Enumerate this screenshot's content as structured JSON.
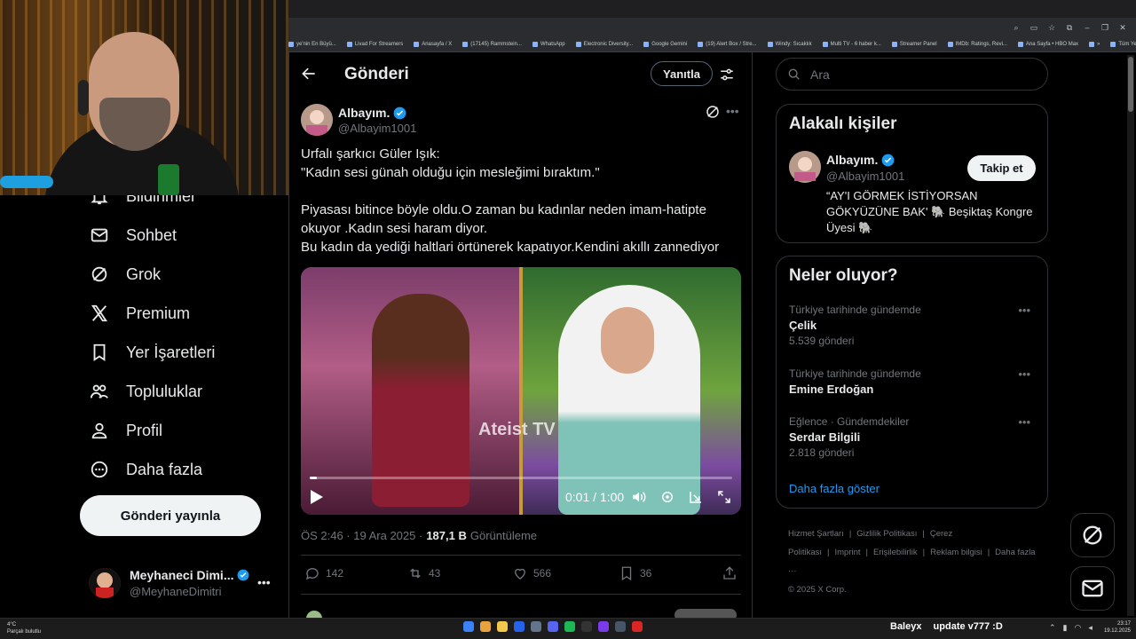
{
  "bookmarks": [
    "ye'nin En Büyü...",
    "Livad For Streamers",
    "Anasayfa / X",
    "(17145) Rammstein...",
    "WhatsApp",
    "Electronic Diversity...",
    "Google Gemini",
    "(19) Alert Box / Stre...",
    "Windy: Sıcaklık",
    "Multi TV - 6 haber k...",
    "Streamer Panel",
    "IMDb: Ratings, Revi...",
    "Ana Sayfa • HBO Max",
    "»",
    "Tüm Yer İşaretleri"
  ],
  "nav": {
    "items": [
      {
        "label": "Bildirimler",
        "icon": "bell-icon"
      },
      {
        "label": "Sohbet",
        "icon": "mail-icon"
      },
      {
        "label": "Grok",
        "icon": "grok-icon"
      },
      {
        "label": "Premium",
        "icon": "x-logo-icon"
      },
      {
        "label": "Yer İşaretleri",
        "icon": "bookmark-icon"
      },
      {
        "label": "Topluluklar",
        "icon": "people-icon"
      },
      {
        "label": "Profil",
        "icon": "person-icon"
      },
      {
        "label": "Daha fazla",
        "icon": "more-circle-icon"
      }
    ],
    "post_button": "Gönderi yayınla",
    "account": {
      "name": "Meyhaneci Dimi...",
      "handle": "@MeyhaneDimitri",
      "more": "•••"
    }
  },
  "post": {
    "header_title": "Gönderi",
    "reply_button": "Yanıtla",
    "author_name": "Albayım.",
    "author_handle": "@Albayim1001",
    "more": "•••",
    "text": "Urfalı şarkıcı Güler Işık:\n\"Kadın sesi günah olduğu için mesleğimi bıraktım.\"\n\nPiyasası bitince böyle oldu.O zaman bu kadınlar neden imam-hatipte okuyor .Kadın sesi haram diyor.\n Bu  kadın da yediği haltlari örtünerek kapatıyor.Kendini akıllı zannediyor",
    "video": {
      "watermark": "Ateist TV",
      "time": "0:01 / 1:00",
      "progress": 0.017
    },
    "meta_time": "ÖS 2:46 · 19 Ara 2025 ·",
    "views_count": "187,1 B",
    "views_label": "Görüntüleme",
    "stats": {
      "replies": "142",
      "reposts": "43",
      "likes": "566",
      "bookmarks": "36"
    }
  },
  "search": {
    "placeholder": "Ara"
  },
  "related": {
    "title": "Alakalı kişiler",
    "name": "Albayım.",
    "handle": "@Albayim1001",
    "follow_button": "Takip et",
    "bio": "“AY'I GÖRMEK İSTİYORSAN GÖKYÜZÜNE BAK' 🐘 Beşiktaş Kongre Üyesi 🐘"
  },
  "trends": {
    "title": "Neler oluyor?",
    "items": [
      {
        "context": "Türkiye tarihinde gündemde",
        "name": "Çelik",
        "count": "5.539 gönderi"
      },
      {
        "context": "Türkiye tarihinde gündemde",
        "name": "Emine Erdoğan",
        "count": ""
      },
      {
        "context": "Eğlence · Gündemdekiler",
        "name": "Serdar Bilgili",
        "count": "2.818 gönderi"
      }
    ],
    "show_more": "Daha fazla göster"
  },
  "footer": {
    "links": [
      "Hizmet Şartları",
      "|",
      "Gizlilik Politikası",
      "|",
      "Çerez Politikası",
      "|",
      "Imprint",
      "|",
      "Erişilebilirlik",
      "|",
      "Reklam bilgisi",
      "|",
      "Daha fazla ···"
    ],
    "copyright": "© 2025 X Corp."
  },
  "taskbar": {
    "weather_temp": "4°C",
    "weather_desc": "Parçalı bulutlu",
    "now_playing_name": "Baleyx",
    "now_playing_text": "update v777 :D",
    "time": "23:17",
    "date": "19.12.2025"
  },
  "colors": {
    "accent": "#1d9bf0",
    "verified": "#1d9bf0",
    "background": "#000000"
  }
}
